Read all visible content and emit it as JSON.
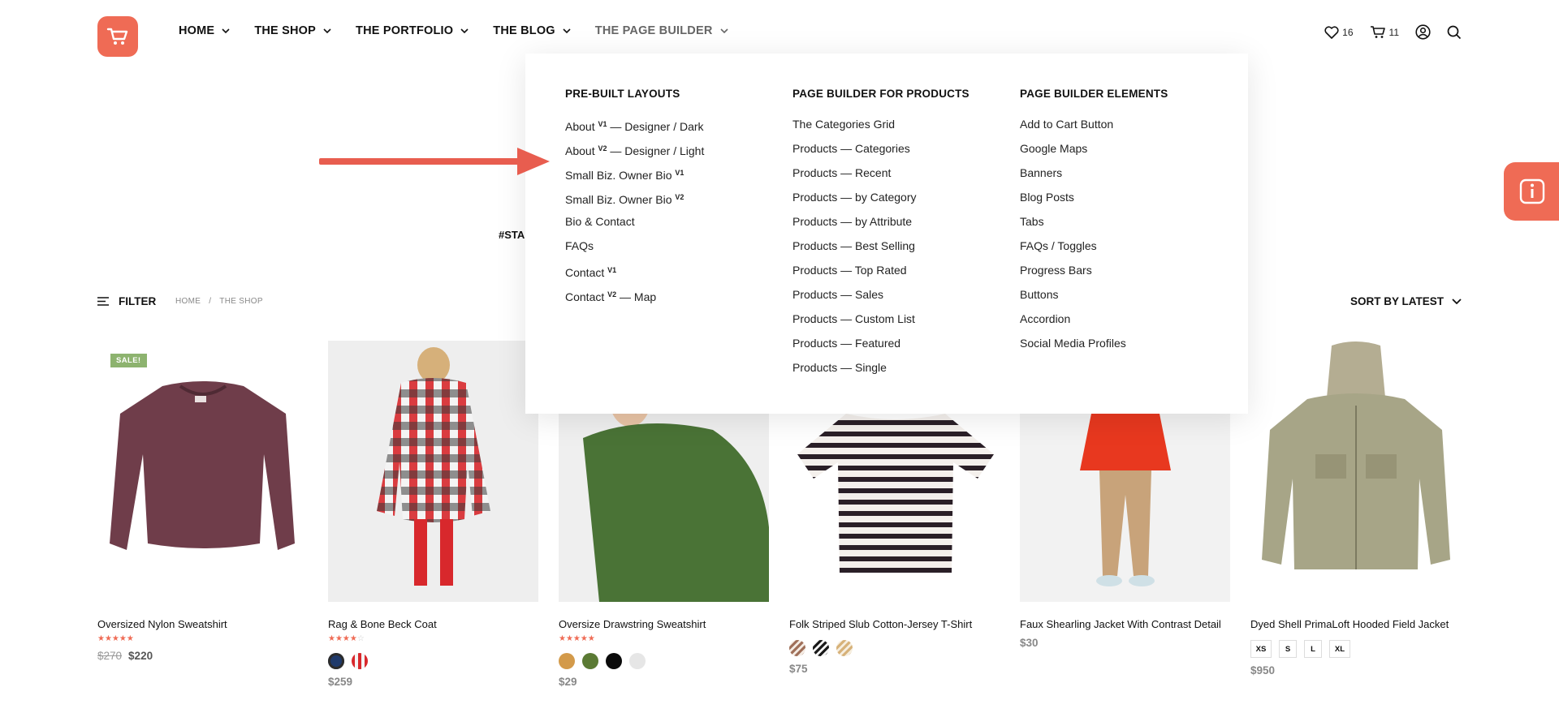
{
  "nav": {
    "items": [
      {
        "label": "HOME"
      },
      {
        "label": "THE SHOP"
      },
      {
        "label": "THE PORTFOLIO"
      },
      {
        "label": "THE BLOG"
      },
      {
        "label": "THE PAGE BUILDER"
      }
    ]
  },
  "header": {
    "wishlist_count": "16",
    "cart_count": "11"
  },
  "mega_menu": {
    "columns": [
      {
        "title": "PRE-BUILT LAYOUTS",
        "items": [
          {
            "text": "About ",
            "sup": "V1",
            "after": " — Designer / Dark"
          },
          {
            "text": "About ",
            "sup": "V2",
            "after": " — Designer / Light"
          },
          {
            "text": "Small Biz. Owner Bio ",
            "sup": "V1",
            "after": ""
          },
          {
            "text": "Small Biz. Owner Bio ",
            "sup": "V2",
            "after": ""
          },
          {
            "text": "Bio & Contact",
            "sup": "",
            "after": ""
          },
          {
            "text": "FAQs",
            "sup": "",
            "after": ""
          },
          {
            "text": "Contact ",
            "sup": "V1",
            "after": ""
          },
          {
            "text": "Contact ",
            "sup": "V2",
            "after": " — Map"
          }
        ]
      },
      {
        "title": "PAGE BUILDER FOR PRODUCTS",
        "items": [
          {
            "text": "The Categories Grid"
          },
          {
            "text": "Products — Categories"
          },
          {
            "text": "Products — Recent"
          },
          {
            "text": "Products — by Category"
          },
          {
            "text": "Products — by Attribute"
          },
          {
            "text": "Products — Best Selling"
          },
          {
            "text": "Products — Top Rated"
          },
          {
            "text": "Products — Sales"
          },
          {
            "text": "Products — Custom List"
          },
          {
            "text": "Products — Featured"
          },
          {
            "text": "Products — Single"
          }
        ]
      },
      {
        "title": "PAGE BUILDER ELEMENTS",
        "items": [
          {
            "text": "Add to Cart Button"
          },
          {
            "text": "Google Maps"
          },
          {
            "text": "Banners"
          },
          {
            "text": "Blog Posts"
          },
          {
            "text": "Tabs"
          },
          {
            "text": "FAQs / Toggles"
          },
          {
            "text": "Progress Bars"
          },
          {
            "text": "Buttons"
          },
          {
            "text": "Accordion"
          },
          {
            "text": "Social Media Profiles"
          }
        ]
      }
    ]
  },
  "tag_partial": "#STA",
  "filter": {
    "label": "FILTER"
  },
  "breadcrumb": {
    "home": "HOME",
    "sep": "/",
    "current": "THE SHOP"
  },
  "sort": {
    "label": "SORT BY LATEST"
  },
  "products": [
    {
      "name": "Oversized Nylon Sweatshirt",
      "badge": "SALE!",
      "rating": 5,
      "old_price": "$270",
      "price": "$220"
    },
    {
      "name": "Rag & Bone Beck Coat",
      "rating": 4,
      "price": "$259"
    },
    {
      "name": "Oversize Drawstring Sweatshirt",
      "rating": 5,
      "price": "$29"
    },
    {
      "name": "Folk Striped Slub Cotton-Jersey T-Shirt",
      "price": "$75"
    },
    {
      "name": "Faux Shearling Jacket With Contrast Detail",
      "price": "$30"
    },
    {
      "name": "Dyed Shell PrimaLoft Hooded Field Jacket",
      "price": "$950",
      "sizes": [
        "XS",
        "S",
        "L",
        "XL"
      ]
    }
  ],
  "colors": {
    "accent": "#ef6b55",
    "sale_badge": "#8db36f"
  }
}
